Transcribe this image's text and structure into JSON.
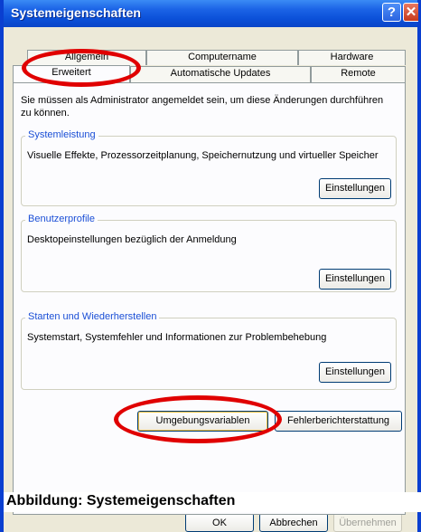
{
  "window": {
    "title": "Systemeigenschaften",
    "help_glyph": "?",
    "close_glyph": "✕"
  },
  "tabs": {
    "row1": [
      "Allgemein",
      "Computername",
      "Hardware"
    ],
    "row2": [
      "Erweitert",
      "Automatische Updates",
      "Remote"
    ],
    "active": "Erweitert"
  },
  "panel": {
    "intro": "Sie müssen als Administrator angemeldet sein, um diese Änderungen durchführen zu können.",
    "groups": [
      {
        "title": "Systemleistung",
        "description": "Visuelle Effekte, Prozessorzeitplanung, Speichernutzung und virtueller Speicher",
        "button": "Einstellungen"
      },
      {
        "title": "Benutzerprofile",
        "description": "Desktopeinstellungen bezüglich der Anmeldung",
        "button": "Einstellungen"
      },
      {
        "title": "Starten und Wiederherstellen",
        "description": "Systemstart, Systemfehler und Informationen zur Problembehebung",
        "button": "Einstellungen"
      }
    ],
    "env_button": "Umgebungsvariablen",
    "error_report_button": "Fehlerberichterstattung"
  },
  "caption": "Abbildung: Systemeigenschaften",
  "footer": {
    "ok": "OK",
    "cancel": "Abbrechen",
    "apply": "Übernehmen"
  },
  "annotation_color": "#e00000",
  "accent_color": "#1b63e6"
}
